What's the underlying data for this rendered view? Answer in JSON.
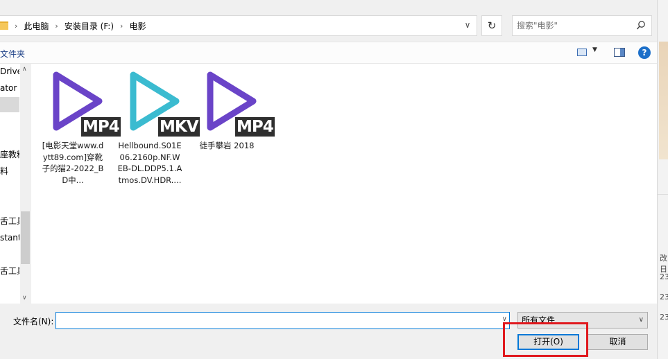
{
  "address_bar": {
    "breadcrumb": [
      "此电脑",
      "安装目录 (F:)",
      "电影"
    ]
  },
  "search": {
    "placeholder": "搜索\"电影\""
  },
  "toolbar": {
    "new_folder_label": "文件夹"
  },
  "nav_pane": {
    "items": [
      "Drive",
      "ator",
      "",
      "",
      "",
      "座教料",
      "料",
      "",
      "",
      "舌工具",
      "stant",
      "",
      "舌工具"
    ],
    "selected_index": 2
  },
  "files": [
    {
      "name": "[电影天堂www.dytt89.com]穿靴子的猫2-2022_BD中...",
      "format": "MP4",
      "icon_color": "#6a44c8"
    },
    {
      "name": "Hellbound.S01E06.2160p.NF.WEB-DL.DDP5.1.Atmos.DV.HDR....",
      "format": "MKV",
      "icon_color": "#3bbbd0"
    },
    {
      "name": "徒手攀岩 2018",
      "format": "MP4",
      "icon_color": "#6a44c8"
    }
  ],
  "bottom": {
    "filename_label": "文件名(N):",
    "filename_value": "",
    "filetype_value": "所有文件",
    "open_button": "打开(O)",
    "cancel_button": "取消"
  },
  "background_window": {
    "fragments": [
      "改日",
      "23",
      "23",
      "23"
    ]
  },
  "colors": {
    "accent": "#0078d7",
    "highlight_box": "#e0191e",
    "mp4_icon": "#6a44c8",
    "mkv_icon": "#3bbbd0"
  }
}
